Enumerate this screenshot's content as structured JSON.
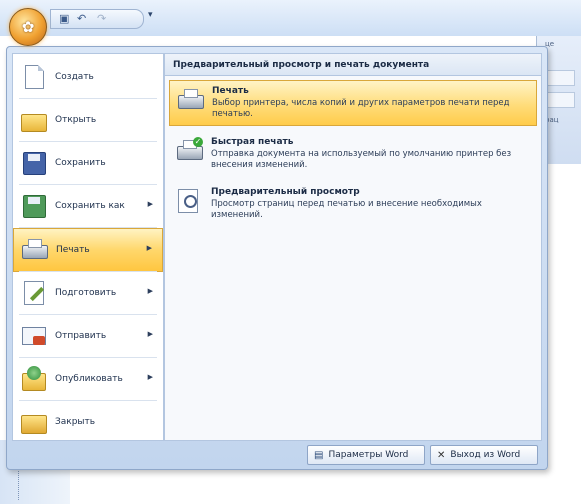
{
  "quick_access": {
    "save_icon": "save-icon",
    "undo_icon": "undo-icon",
    "redo_icon": "redo-icon",
    "customize_icon": "dropdown-arrow-icon"
  },
  "left_menu": {
    "items": [
      {
        "label": "Создать",
        "icon": "new-document-icon",
        "submenu": false
      },
      {
        "label": "Открыть",
        "icon": "open-folder-icon",
        "submenu": false
      },
      {
        "label": "Сохранить",
        "icon": "save-icon",
        "submenu": false
      },
      {
        "label": "Сохранить как",
        "icon": "save-as-icon",
        "submenu": true
      },
      {
        "label": "Печать",
        "icon": "printer-icon",
        "submenu": true,
        "active": true
      },
      {
        "label": "Подготовить",
        "icon": "prepare-icon",
        "submenu": true
      },
      {
        "label": "Отправить",
        "icon": "send-icon",
        "submenu": true
      },
      {
        "label": "Опубликовать",
        "icon": "publish-icon",
        "submenu": true
      },
      {
        "label": "Закрыть",
        "icon": "close-folder-icon",
        "submenu": false
      }
    ]
  },
  "right_panel": {
    "header": "Предварительный просмотр и печать документа",
    "options": [
      {
        "title": "Печать",
        "description": "Выбор принтера, числа копий и других параметров печати перед печатью.",
        "icon": "printer-icon",
        "active": true
      },
      {
        "title": "Быстрая печать",
        "description": "Отправка документа на используемый по умолчанию принтер без внесения изменений.",
        "icon": "quick-print-icon",
        "active": false
      },
      {
        "title": "Предварительный просмотр",
        "description": "Просмотр страниц перед печатью и внесение необходимых изменений.",
        "icon": "print-preview-icon",
        "active": false
      }
    ]
  },
  "footer": {
    "options_button": "Параметры Word",
    "exit_button": "Выход из Word"
  },
  "ribbon_fragment": {
    "tab_text": "це",
    "group_text": "рац"
  }
}
